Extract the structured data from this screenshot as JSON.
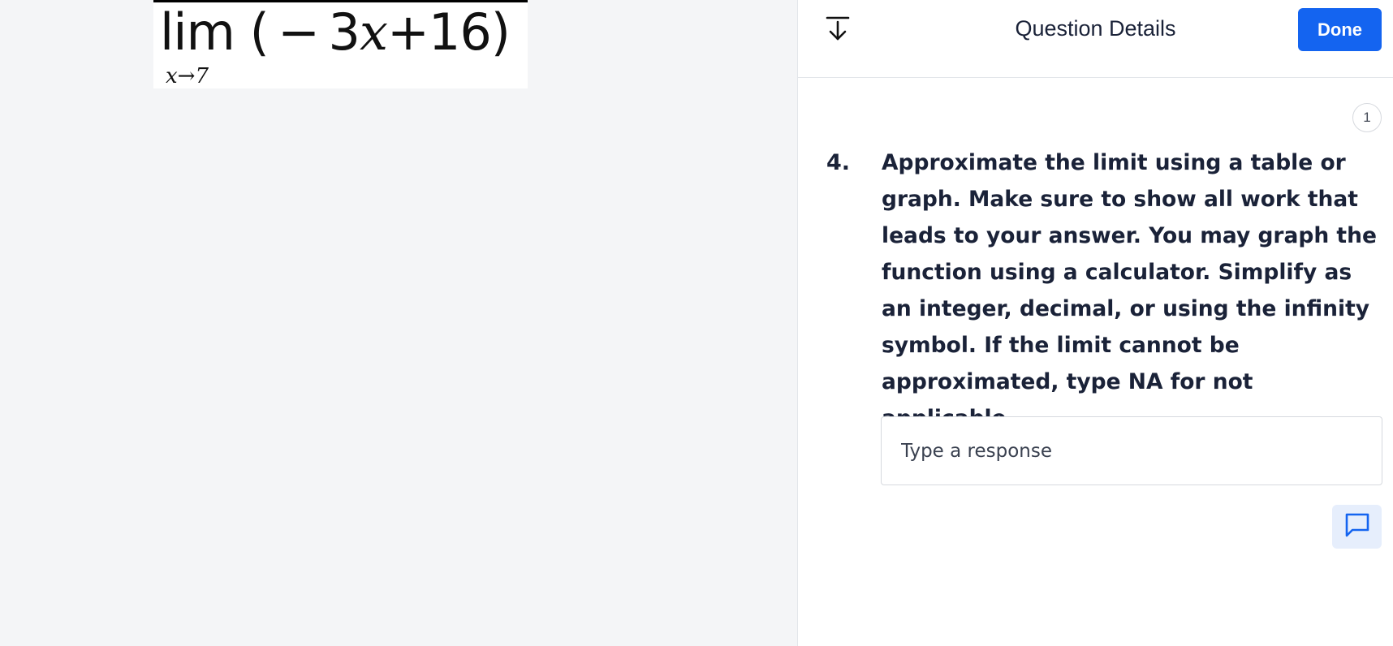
{
  "left_pane": {
    "math_image": {
      "expression_parts": [
        "lim",
        "(",
        "−",
        "3",
        "x",
        "+16)"
      ],
      "subscript_parts": [
        "x",
        "→7"
      ]
    }
  },
  "header": {
    "collapse_icon": "collapse-down-arrow-icon",
    "title": "Question Details",
    "done_label": "Done"
  },
  "question": {
    "count_badge": "1",
    "number": "4.",
    "text": "Approximate the limit using a table or graph. Make sure to show all work that leads to your answer. You may graph the function using a calculator. Simplify as an integer, decimal, or using the infinity symbol. If the limit cannot be approximated, type NA for not applicable.",
    "response_placeholder": "Type a response",
    "response_value": ""
  },
  "comment_icon": "comment-icon",
  "colors": {
    "accent": "#1464f0",
    "accent_light": "#e6eefc",
    "text": "#1a2238",
    "background": "#f4f5f7"
  }
}
